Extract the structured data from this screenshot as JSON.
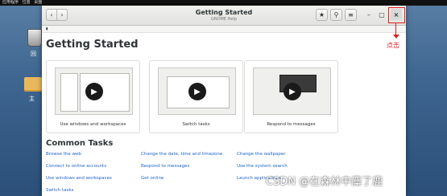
{
  "desktop": {
    "topbar": [
      "应用程序",
      "位置",
      "桌面"
    ],
    "icons": [
      {
        "label": "回"
      },
      {
        "label": "主"
      }
    ]
  },
  "window": {
    "title": "Getting Started",
    "subtitle": "GNOME Help",
    "breadcrumb": "",
    "buttons": {
      "back": "‹",
      "forward": "›",
      "star": "★",
      "search": "⚲",
      "menu": "≡",
      "minimize": "–",
      "maximize": "▢",
      "close": "×"
    }
  },
  "content": {
    "heading": "Getting Started",
    "videos": [
      {
        "caption": "Use windows and workspaces"
      },
      {
        "caption": "Switch tasks"
      },
      {
        "caption": "Respond to messages"
      }
    ],
    "common_heading": "Common Tasks",
    "tasks": [
      [
        "Browse the web",
        "Connect to online accounts",
        "Use windows and workspaces",
        "Switch tasks"
      ],
      [
        "Change the date, time and timezone",
        "Respond to messages",
        "Get online"
      ],
      [
        "Change the wallpaper",
        "Use the system search",
        "Launch applications"
      ]
    ]
  },
  "annotation": {
    "label": "点击",
    "color": "#e02020"
  },
  "watermark": "CSDN @在森林中麋了鹿"
}
